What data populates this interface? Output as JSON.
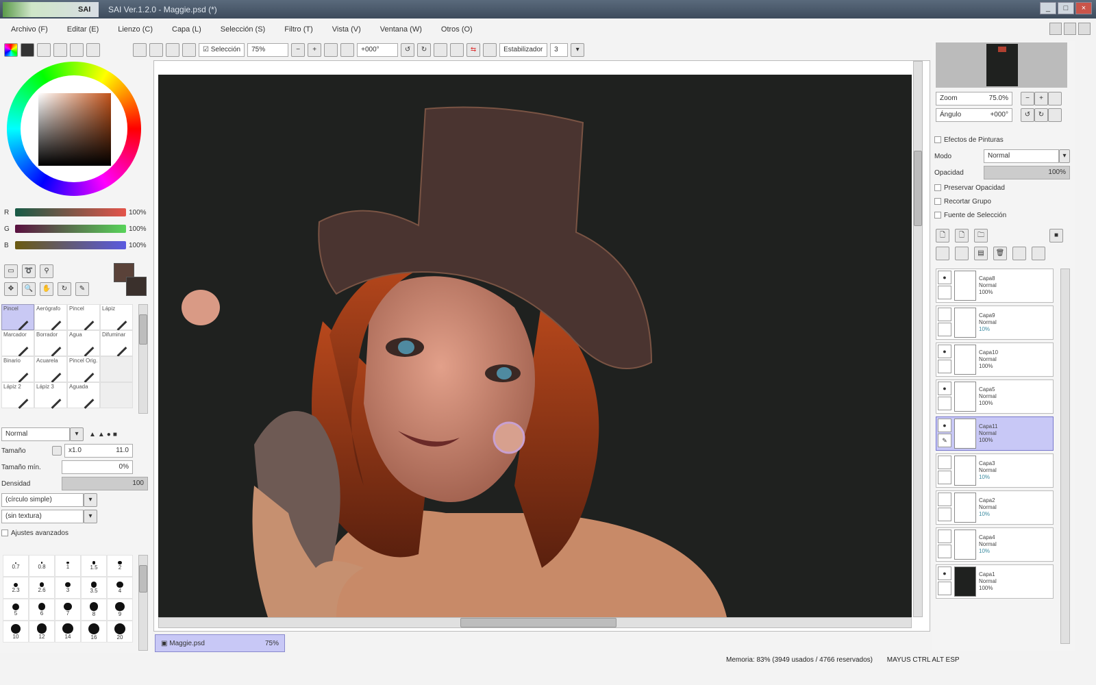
{
  "app": {
    "name": "SAI",
    "title": "SAI Ver.1.2.0 - Maggie.psd (*)"
  },
  "window_buttons": [
    "_",
    "□",
    "×"
  ],
  "menu": [
    "Archivo (F)",
    "Editar (E)",
    "Lienzo (C)",
    "Capa (L)",
    "Selección (S)",
    "Filtro (T)",
    "Vista (V)",
    "Ventana (W)",
    "Otros (O)"
  ],
  "toolbar": {
    "selection_label": "Selección",
    "zoom": "75%",
    "rotation": "+000°",
    "stabilizer_label": "Estabilizador",
    "stabilizer_value": "3"
  },
  "color": {
    "sliders": [
      {
        "label": "R",
        "value": "100%",
        "fill": 0.5
      },
      {
        "label": "G",
        "value": "100%",
        "fill": 0.4
      },
      {
        "label": "B",
        "value": "100%",
        "fill": 0.35
      }
    ],
    "primary": "#5a4239",
    "secondary": "#3a302c"
  },
  "tools": [
    "Pincel",
    "Aerógrafo",
    "Pincel",
    "Lápiz",
    "Marcador",
    "Borrador",
    "Agua",
    "Difuminar",
    "Binario",
    "Acuarela",
    "Pincel Orig.",
    "",
    "Lápiz 2",
    "Lápiz 3",
    "Aguada",
    ""
  ],
  "brush": {
    "mode": "Normal",
    "size_label": "Tamaño",
    "size_value": "x1.0",
    "size_num": "11.0",
    "min_size_label": "Tamaño mín.",
    "min_size_value": "0%",
    "density_label": "Densidad",
    "density_value": "100",
    "shape1": "(círculo simple)",
    "shape2": "(sin textura)",
    "advanced_label": "Ajustes avanzados",
    "dot_sizes": [
      "0.7",
      "0.8",
      "1",
      "1.5",
      "2",
      "2.3",
      "2.6",
      "3",
      "3.5",
      "4",
      "5",
      "6",
      "7",
      "8",
      "9",
      "10",
      "12",
      "14",
      "16",
      "20"
    ]
  },
  "navigator": {
    "zoom_label": "Zoom",
    "zoom_value": "75.0%",
    "angle_label": "Ángulo",
    "angle_value": "+000°"
  },
  "layer_panel": {
    "effects_label": "Efectos de Pinturas",
    "mode_label": "Modo",
    "mode_value": "Normal",
    "opacity_label": "Opacidad",
    "opacity_value": "100%",
    "opacity_fill": 1.0,
    "checks": [
      "Preservar Opacidad",
      "Recortar Grupo",
      "Fuente de Selección"
    ]
  },
  "layers": [
    {
      "name": "Capa8",
      "mode": "Normal",
      "opacity": "100%",
      "visible": true
    },
    {
      "name": "Capa9",
      "mode": "Normal",
      "opacity": "10%",
      "visible": false
    },
    {
      "name": "Capa10",
      "mode": "Normal",
      "opacity": "100%",
      "visible": true
    },
    {
      "name": "Capa5",
      "mode": "Normal",
      "opacity": "100%",
      "visible": true
    },
    {
      "name": "Capa11",
      "mode": "Normal",
      "opacity": "100%",
      "visible": true,
      "selected": true
    },
    {
      "name": "Capa3",
      "mode": "Normal",
      "opacity": "10%",
      "visible": false
    },
    {
      "name": "Capa2",
      "mode": "Normal",
      "opacity": "10%",
      "visible": false
    },
    {
      "name": "Capa4",
      "mode": "Normal",
      "opacity": "10%",
      "visible": false
    },
    {
      "name": "Capa1",
      "mode": "Normal",
      "opacity": "100%",
      "visible": true
    }
  ],
  "document_tab": {
    "name": "Maggie.psd",
    "zoom": "75%"
  },
  "status": {
    "memory": "Memoria: 83% (3949 usados / 4766 reservados)",
    "keys": "MAYUS CTRL ALT ESP"
  }
}
